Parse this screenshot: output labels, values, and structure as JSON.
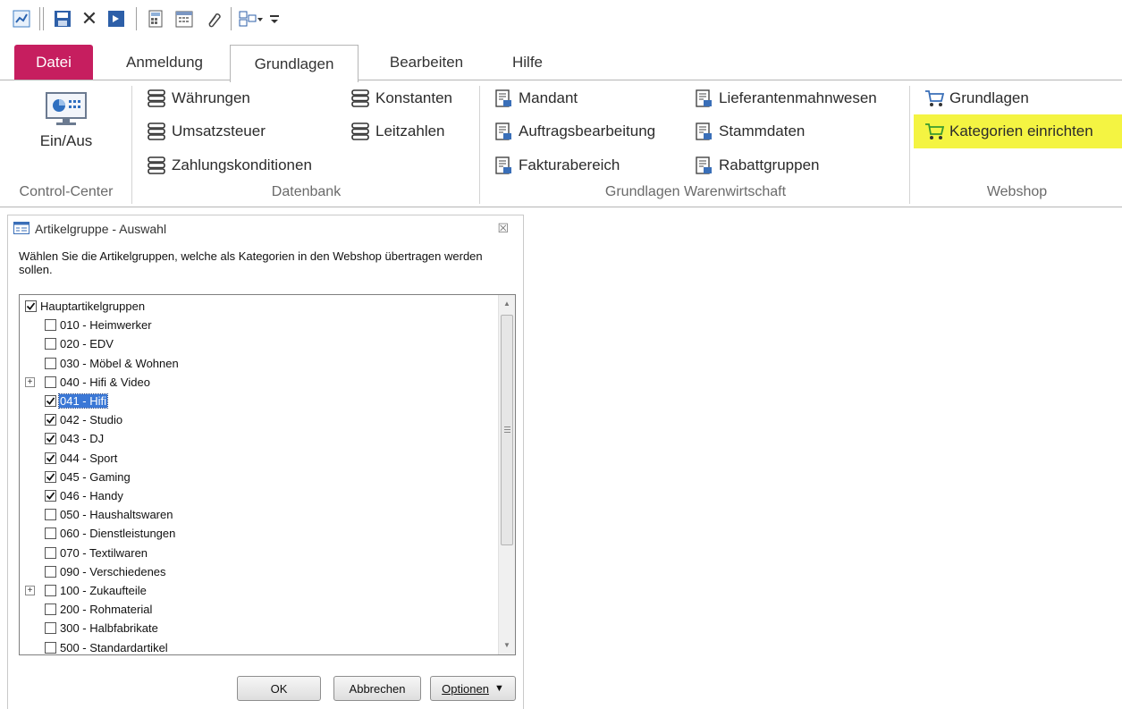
{
  "quick_access": {
    "icons": [
      "chart-icon",
      "save-icon",
      "close-icon",
      "export-icon",
      "calculator-icon",
      "calendar-icon",
      "attach-icon",
      "layout-icon",
      "dropdown-icon"
    ]
  },
  "tabs": [
    {
      "label": "Datei"
    },
    {
      "label": "Anmeldung"
    },
    {
      "label": "Grundlagen"
    },
    {
      "label": "Bearbeiten"
    },
    {
      "label": "Hilfe"
    }
  ],
  "ribbon": {
    "control_center": {
      "button": "Ein/Aus",
      "label": "Control-Center"
    },
    "datenbank": {
      "label": "Datenbank",
      "items": [
        "Währungen",
        "Umsatzsteuer",
        "Zahlungskonditionen",
        "Konstanten",
        "Leitzahlen"
      ]
    },
    "warenwirtschaft": {
      "label": "Grundlagen Warenwirtschaft",
      "items": [
        "Mandant",
        "Auftragsbearbeitung",
        "Fakturabereich",
        "Lieferantenmahnwesen",
        "Stammdaten",
        "Rabattgruppen"
      ]
    },
    "webshop": {
      "label": "Webshop",
      "items": [
        "Grundlagen",
        "Kategorien einrichten"
      ],
      "highlight_color": "#f4f442"
    }
  },
  "dialog": {
    "title": "Artikelgruppe - Auswahl",
    "close_glyph": "☒",
    "message": "Wählen Sie die Artikelgruppen, welche als Kategorien in den Webshop übertragen werden sollen.",
    "tree": [
      {
        "label": "Hauptartikelgruppen",
        "checked": true,
        "level": 0
      },
      {
        "label": "010 - Heimwerker",
        "checked": false,
        "level": 1
      },
      {
        "label": "020 - EDV",
        "checked": false,
        "level": 1
      },
      {
        "label": "030 - Möbel & Wohnen",
        "checked": false,
        "level": 1
      },
      {
        "label": "040 - Hifi & Video",
        "checked": false,
        "level": 1,
        "expandable": true
      },
      {
        "label": "041 - Hifi",
        "checked": true,
        "level": 1,
        "selected": true
      },
      {
        "label": "042 - Studio",
        "checked": true,
        "level": 1
      },
      {
        "label": "043 - DJ",
        "checked": true,
        "level": 1
      },
      {
        "label": "044 - Sport",
        "checked": true,
        "level": 1
      },
      {
        "label": "045 - Gaming",
        "checked": true,
        "level": 1
      },
      {
        "label": "046 - Handy",
        "checked": true,
        "level": 1
      },
      {
        "label": "050 - Haushaltswaren",
        "checked": false,
        "level": 1
      },
      {
        "label": "060 - Dienstleistungen",
        "checked": false,
        "level": 1
      },
      {
        "label": "070 - Textilwaren",
        "checked": false,
        "level": 1
      },
      {
        "label": "090 - Verschiedenes",
        "checked": false,
        "level": 1
      },
      {
        "label": "100 - Zukaufteile",
        "checked": false,
        "level": 1,
        "expandable": true
      },
      {
        "label": "200 - Rohmaterial",
        "checked": false,
        "level": 1
      },
      {
        "label": "300 - Halbfabrikate",
        "checked": false,
        "level": 1
      },
      {
        "label": "500 - Standardartikel",
        "checked": false,
        "level": 1
      }
    ],
    "buttons": {
      "ok": "OK",
      "cancel": "Abbrechen",
      "options": "Optionen",
      "options_arrow": "▼"
    }
  },
  "colors": {
    "file_tab": "#c61e5f",
    "selection": "#3b78d6",
    "cart": "#3a9a2e"
  }
}
